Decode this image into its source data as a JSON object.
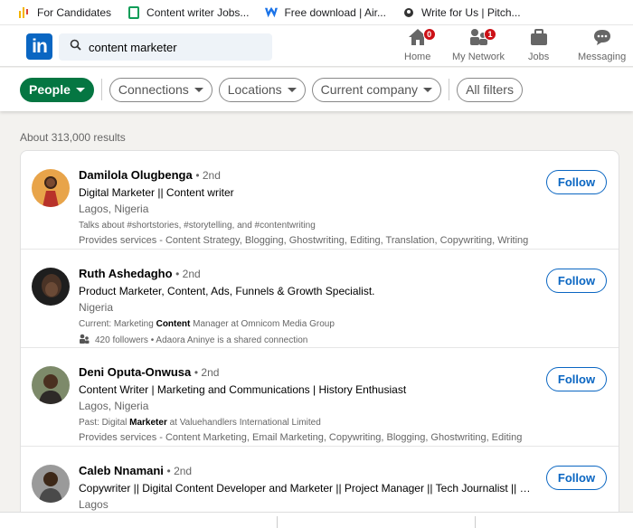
{
  "bookmarks": [
    {
      "label": "For Candidates"
    },
    {
      "label": "Content writer Jobs..."
    },
    {
      "label": "Free download | Air..."
    },
    {
      "label": "Write for Us | Pitch..."
    }
  ],
  "header": {
    "logo_text": "in",
    "search_value": "content marketer",
    "nav": [
      {
        "label": "Home",
        "badge": "0"
      },
      {
        "label": "My Network",
        "badge": "1"
      },
      {
        "label": "Jobs"
      },
      {
        "label": "Messaging"
      }
    ]
  },
  "filters": {
    "people": "People",
    "connections": "Connections",
    "locations": "Locations",
    "current_company": "Current company",
    "all_filters": "All filters"
  },
  "results_count": "About 313,000 results",
  "results": [
    {
      "name": "Damilola Olugbenga",
      "degree": "• 2nd",
      "headline": "Digital Marketer || Content writer",
      "location": "Lagos, Nigeria",
      "meta1": "Talks about #shortstories, #storytelling, and #contentwriting",
      "meta2": "Provides services - Content Strategy, Blogging, Ghostwriting, Editing, Translation, Copywriting, Writing",
      "follow": "Follow"
    },
    {
      "name": "Ruth Ashedagho",
      "degree": "• 2nd",
      "headline": "Product Marketer, Content, Ads, Funnels & Growth Specialist.",
      "location": "Nigeria",
      "meta1_pre": "Current: Marketing ",
      "meta1_bold": "Content",
      "meta1_post": " Manager at Omnicom Media Group",
      "meta2": "420 followers • Adaora Aninye is a shared connection",
      "follow": "Follow"
    },
    {
      "name": "Deni Oputa-Onwusa",
      "degree": "• 2nd",
      "headline": "Content Writer | Marketing and Communications | History Enthusiast",
      "location": "Lagos, Nigeria",
      "meta1_pre": "Past: Digital ",
      "meta1_bold": "Marketer",
      "meta1_post": " at Valuehandlers International Limited",
      "meta2": "Provides services - Content Marketing, Email Marketing, Copywriting, Blogging, Ghostwriting, Editing",
      "follow": "Follow"
    },
    {
      "name": "Caleb Nnamani",
      "degree": "• 2nd",
      "headline": "Copywriter || Digital Content Developer and Marketer || Project Manager || Tech Journalist || C...",
      "location": "Lagos",
      "follow": "Follow"
    }
  ],
  "colors": {
    "brand": "#0a66c2",
    "people_pill": "#057642",
    "badge": "#cc1016"
  }
}
